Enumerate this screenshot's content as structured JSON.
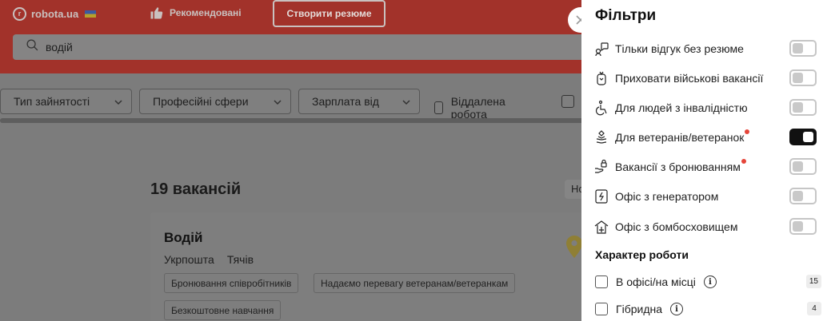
{
  "header": {
    "logo_text": "robota.ua",
    "recommended_label": "Рекомендовані",
    "create_cv_label": "Створити резюме",
    "search_value": "водій"
  },
  "filters_bar": {
    "employment_type": "Тип зайнятості",
    "professional_areas": "Професійні сфери",
    "salary_from": "Зарплата від",
    "remote_work": "Віддалена робота"
  },
  "results": {
    "count_title": "19 вакансій",
    "sort_label": "Но"
  },
  "card": {
    "title": "Водій",
    "company": "Укрпошта",
    "city": "Тячів",
    "tags": [
      "Бронювання співробітників",
      "Надаємо перевагу ветеранам/ветеранкам",
      "Безкоштовне навчання"
    ]
  },
  "drawer": {
    "title": "Фільтри",
    "toggles": [
      {
        "icon": "speech-bubble-icon",
        "label": "Тільки відгук без резюме",
        "on": false,
        "dot": false
      },
      {
        "icon": "military-tag-icon",
        "label": "Приховати військові вакансії",
        "on": false,
        "dot": false
      },
      {
        "icon": "wheelchair-icon",
        "label": "Для людей з інвалідністю",
        "on": false,
        "dot": false
      },
      {
        "icon": "veteran-badge-icon",
        "label": "Для ветеранів/ветеранок",
        "on": true,
        "dot": true
      },
      {
        "icon": "hand-lock-icon",
        "label": "Вакансії з бронюванням",
        "on": false,
        "dot": true
      },
      {
        "icon": "generator-icon",
        "label": "Офіс з генератором",
        "on": false,
        "dot": false
      },
      {
        "icon": "shelter-icon",
        "label": "Офіс з бомбосховищем",
        "on": false,
        "dot": false
      }
    ],
    "work_type_title": "Характер роботи",
    "work_types": [
      {
        "label": "В офісі/на місці",
        "count": "15"
      },
      {
        "label": "Гібридна",
        "count": "4"
      }
    ]
  },
  "colors": {
    "header_red": "#a2322a",
    "overlay_gray": "#7c7c7c",
    "toggle_on": "#111111",
    "dot_red": "#e5453a"
  }
}
